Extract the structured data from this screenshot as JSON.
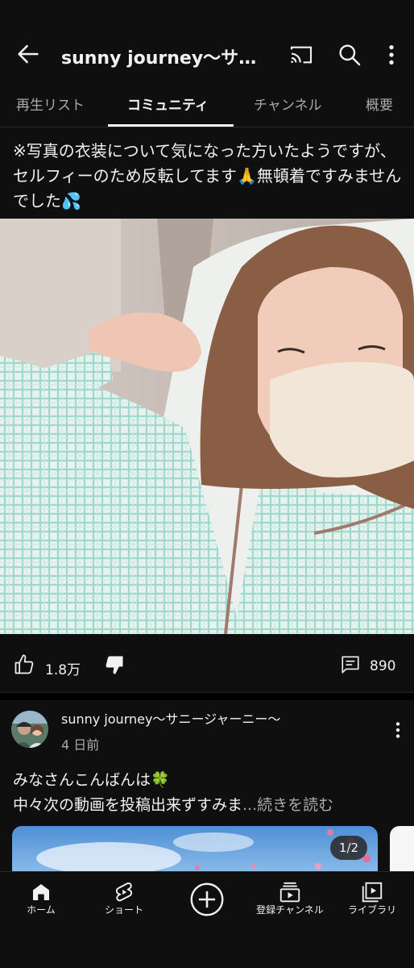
{
  "header": {
    "title": "sunny journey〜サニ…",
    "icons": [
      "back-arrow-icon",
      "cast-icon",
      "search-icon",
      "more-vert-icon"
    ]
  },
  "tabs": [
    {
      "label": "再生リスト",
      "active": false
    },
    {
      "label": "コミュニティ",
      "active": true
    },
    {
      "label": "チャンネル",
      "active": false
    },
    {
      "label": "概要",
      "active": false
    }
  ],
  "post1": {
    "text": "※写真の衣装について気になった方いたようですが、セルフィーのため反転してます🙏無頓着ですみませんでした💦",
    "likes": "1.8万",
    "comments": "890"
  },
  "post2": {
    "author": "sunny journey〜サニージャーニー〜",
    "time": "4 日前",
    "line1": "みなさんこんばんは🍀",
    "line2": "中々次の動画を投稿出来ずすみま",
    "read_more": "...続きを読む",
    "image_counter": "1/2"
  },
  "bottom_nav": [
    {
      "label": "ホーム",
      "icon": "home-icon"
    },
    {
      "label": "ショート",
      "icon": "shorts-icon"
    },
    {
      "label": "",
      "icon": "create-icon"
    },
    {
      "label": "登録チャンネル",
      "icon": "subscriptions-icon"
    },
    {
      "label": "ライブラリ",
      "icon": "library-icon"
    }
  ],
  "colors": {
    "background": "#0f0f0f",
    "text_primary": "#f1f1f1",
    "text_secondary": "#aaaaaa"
  }
}
